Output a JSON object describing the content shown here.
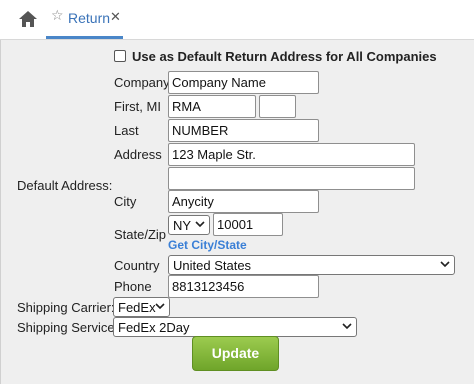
{
  "tabs": [
    {
      "label": "Return",
      "active": true
    }
  ],
  "form": {
    "default_checkbox_label": "Use as Default Return Address for All Companies",
    "default_checkbox_checked": false,
    "default_address_label": "Default Address:",
    "company_label": "Company",
    "company_value": "Company Name",
    "first_mi_label": "First, MI",
    "first_value": "RMA",
    "mi_value": "",
    "last_label": "Last",
    "last_value": "NUMBER",
    "address_label": "Address",
    "address1_value": "123 Maple Str.",
    "address2_value": "",
    "city_label": "City",
    "city_value": "Anycity",
    "state_zip_label": "State/Zip",
    "state_value": "NY",
    "zip_value": "10001",
    "get_city_state_link": "Get City/State",
    "country_label": "Country",
    "country_value": "United States",
    "phone_label": "Phone",
    "phone_value": "8813123456",
    "shipping_carrier_label": "Shipping Carrier:",
    "shipping_carrier_value": "FedEx",
    "shipping_service_label": "Shipping Service:",
    "shipping_service_value": "FedEx 2Day",
    "update_button": "Update"
  },
  "colors": {
    "tab_accent": "#4a86c8",
    "link": "#3a7fd6",
    "button_green": "#7cb534"
  }
}
